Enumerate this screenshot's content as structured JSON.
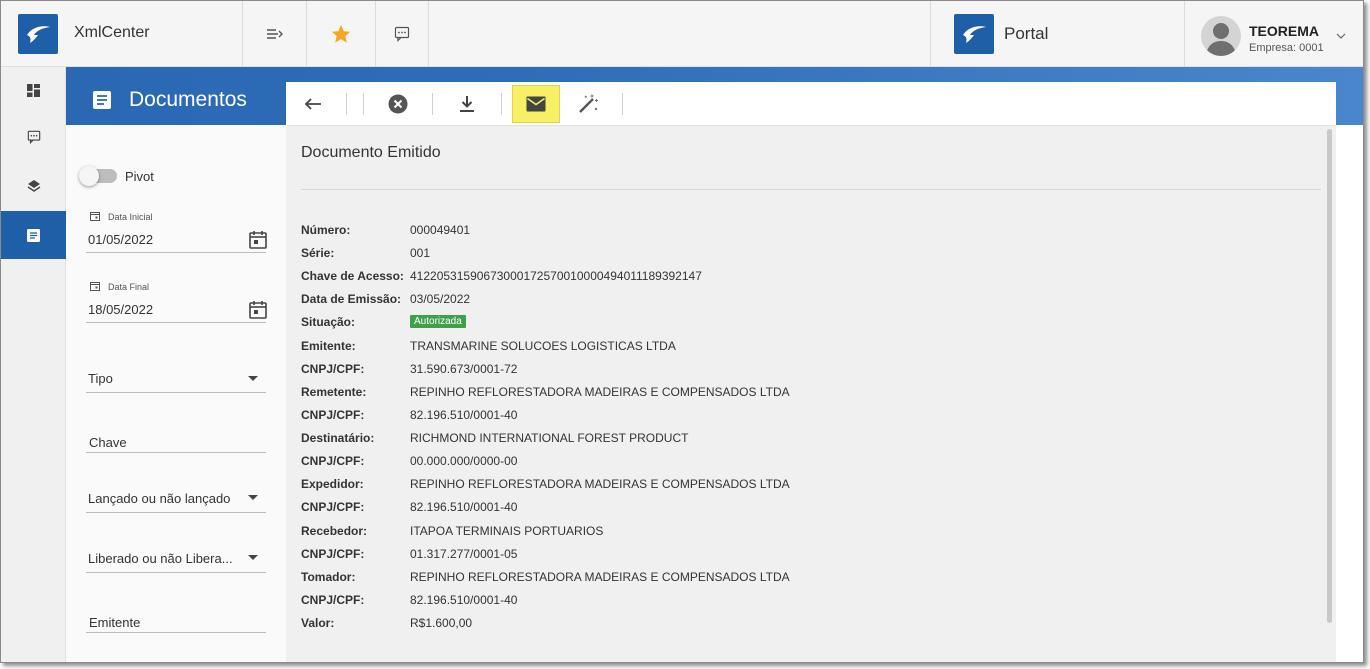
{
  "topbar": {
    "app_title": "XmlCenter",
    "portal_title": "Portal",
    "user_name": "TEOREMA",
    "user_company": "Empresa: 0001",
    "icons": [
      "menu-collapse-icon",
      "star-icon",
      "chat-icon"
    ],
    "star_color": "#f5a623"
  },
  "rail": {
    "items": [
      "dashboard-icon",
      "chat-icon",
      "layers-icon",
      "document-icon"
    ],
    "active_index": 3,
    "accent": "#1f5fa8"
  },
  "band": {
    "title": "Documentos"
  },
  "filters": {
    "pivot_label": "Pivot",
    "pivot_on": false,
    "data_inicial_label": "Data Inicial",
    "data_inicial_value": "01/05/2022",
    "data_final_label": "Data Final",
    "data_final_value": "18/05/2022",
    "tipo": "Tipo",
    "chave": "Chave",
    "lancado": "Lançado ou não lançado",
    "liberado": "Liberado ou não Libera...",
    "emitente": "Emitente"
  },
  "toolbar": {
    "buttons": [
      "back-arrow-icon",
      "cancel-circle-icon",
      "download-icon",
      "email-icon",
      "magic-wand-icon"
    ],
    "highlight": "#f7f064"
  },
  "document": {
    "heading": "Documento Emitido",
    "status_color": "#3fa04a",
    "fields": [
      {
        "label": "Número:",
        "value": "000049401"
      },
      {
        "label": "Série:",
        "value": "001"
      },
      {
        "label": "Chave de Acesso:",
        "value": "41220531590673000172570010000494011189392147"
      },
      {
        "label": "Data de Emissão:",
        "value": "03/05/2022"
      },
      {
        "label": "Situação:",
        "value": "Autorizada"
      },
      {
        "label": "Emitente:",
        "value": "TRANSMARINE SOLUCOES LOGISTICAS LTDA"
      },
      {
        "label": "CNPJ/CPF:",
        "value": "31.590.673/0001-72"
      },
      {
        "label": "Remetente:",
        "value": "REPINHO REFLORESTADORA MADEIRAS E COMPENSADOS LTDA"
      },
      {
        "label": "CNPJ/CPF:",
        "value": "82.196.510/0001-40"
      },
      {
        "label": "Destinatário:",
        "value": "RICHMOND INTERNATIONAL FOREST PRODUCT"
      },
      {
        "label": "CNPJ/CPF:",
        "value": "00.000.000/0000-00"
      },
      {
        "label": "Expedidor:",
        "value": "REPINHO REFLORESTADORA MADEIRAS E COMPENSADOS LTDA"
      },
      {
        "label": "CNPJ/CPF:",
        "value": "82.196.510/0001-40"
      },
      {
        "label": "Recebedor:",
        "value": "ITAPOA TERMINAIS PORTUARIOS"
      },
      {
        "label": "CNPJ/CPF:",
        "value": "01.317.277/0001-05"
      },
      {
        "label": "Tomador:",
        "value": "REPINHO REFLORESTADORA MADEIRAS E COMPENSADOS LTDA"
      },
      {
        "label": "CNPJ/CPF:",
        "value": "82.196.510/0001-40"
      },
      {
        "label": "Valor:",
        "value": "R$1.600,00"
      }
    ]
  }
}
